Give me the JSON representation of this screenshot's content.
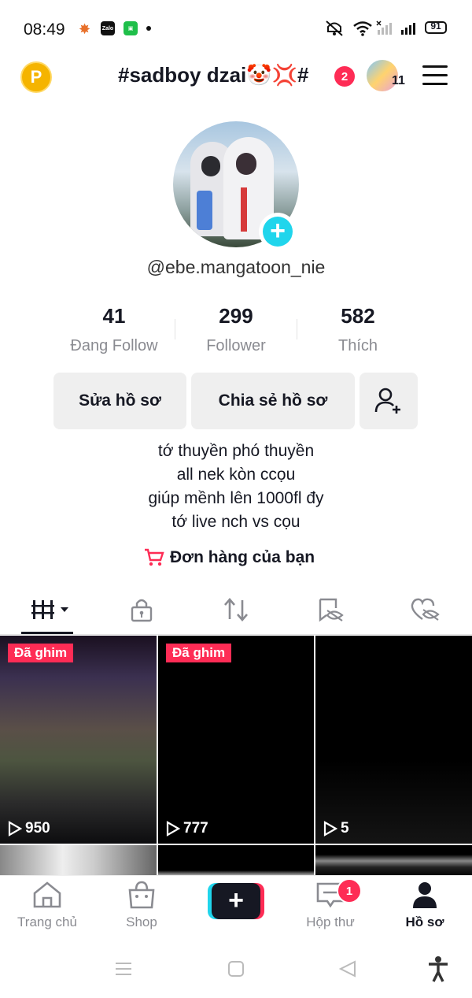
{
  "status_bar": {
    "time": "08:49",
    "app_icons": [
      "photos-icon",
      "zalo-icon",
      "wechat-icon"
    ],
    "zalo_label": "Zalo",
    "battery": "91"
  },
  "header": {
    "points_label": "P",
    "username": "#sadboy dzai🤡💢#",
    "username_badge": "2",
    "friends_count": "11"
  },
  "profile": {
    "handle": "@ebe.mangatoon_nie",
    "stats": [
      {
        "value": "41",
        "label": "Đang Follow"
      },
      {
        "value": "299",
        "label": "Follower"
      },
      {
        "value": "582",
        "label": "Thích"
      }
    ],
    "edit_button": "Sửa hồ sơ",
    "share_button": "Chia sẻ hồ sơ",
    "bio": [
      "tớ thuyền phó thuyền",
      "all nek kòn ccọu",
      "giúp mềnh lên 1000fl đy",
      "tớ live nch vs cọu"
    ],
    "orders_label": "Đơn hàng của bạn"
  },
  "videos": [
    {
      "pinned": "Đã ghim",
      "views": "950"
    },
    {
      "pinned": "Đã ghim",
      "views": "777"
    },
    {
      "pinned": "",
      "views": "5"
    }
  ],
  "bottom_nav": [
    {
      "label": "Trang chủ"
    },
    {
      "label": "Shop"
    },
    {
      "label": ""
    },
    {
      "label": "Hộp thư",
      "badge": "1"
    },
    {
      "label": "Hồ sơ"
    }
  ],
  "colors": {
    "accent": "#fe2c55",
    "cyan": "#20d5ec",
    "text": "#161823",
    "muted": "#8a8b91"
  }
}
